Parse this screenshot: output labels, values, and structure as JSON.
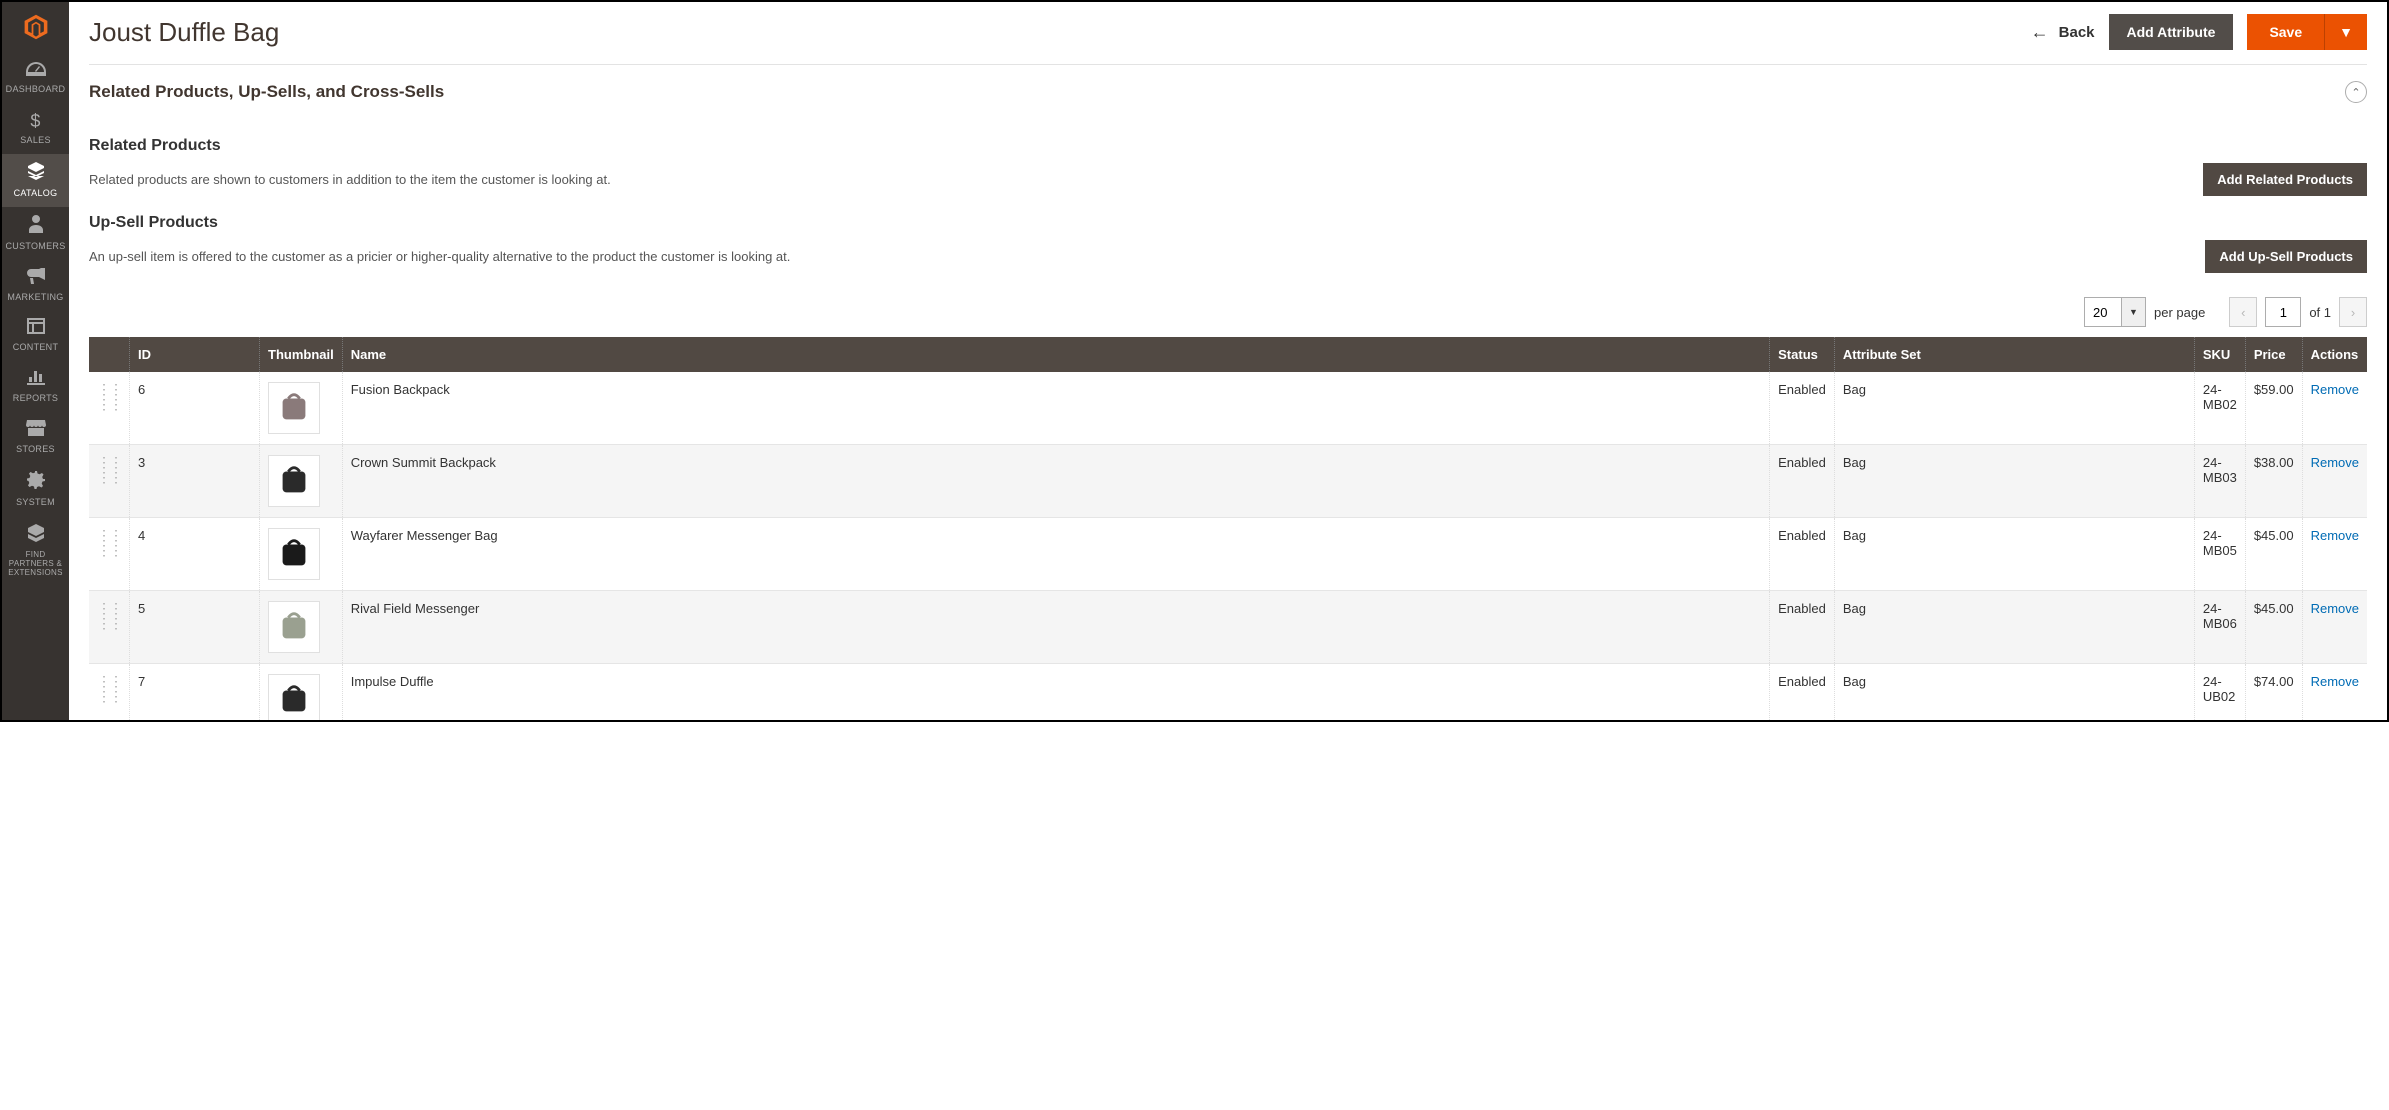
{
  "page_title": "Joust Duffle Bag",
  "header": {
    "back_label": "Back",
    "add_attribute_label": "Add Attribute",
    "save_label": "Save"
  },
  "sidebar": {
    "items": [
      {
        "label": "DASHBOARD"
      },
      {
        "label": "SALES"
      },
      {
        "label": "CATALOG"
      },
      {
        "label": "CUSTOMERS"
      },
      {
        "label": "MARKETING"
      },
      {
        "label": "CONTENT"
      },
      {
        "label": "REPORTS"
      },
      {
        "label": "STORES"
      },
      {
        "label": "SYSTEM"
      },
      {
        "label": "FIND PARTNERS & EXTENSIONS"
      }
    ]
  },
  "section": {
    "title": "Related Products, Up-Sells, and Cross-Sells"
  },
  "related": {
    "title": "Related Products",
    "desc": "Related products are shown to customers in addition to the item the customer is looking at.",
    "add_label": "Add Related Products"
  },
  "upsell": {
    "title": "Up-Sell Products",
    "desc": "An up-sell item is offered to the customer as a pricier or higher-quality alternative to the product the customer is looking at.",
    "add_label": "Add Up-Sell Products"
  },
  "pager": {
    "per_page_value": "20",
    "per_page_label": "per page",
    "page_value": "1",
    "of_label": "of 1"
  },
  "columns": {
    "id": "ID",
    "thumbnail": "Thumbnail",
    "name": "Name",
    "status": "Status",
    "attribute_set": "Attribute Set",
    "sku": "SKU",
    "price": "Price",
    "actions": "Actions"
  },
  "rows": [
    {
      "id": "6",
      "name": "Fusion Backpack",
      "status": "Enabled",
      "attribute_set": "Bag",
      "sku": "24-MB02",
      "price": "$59.00",
      "action": "Remove",
      "color": "#8a7a7a"
    },
    {
      "id": "3",
      "name": "Crown Summit Backpack",
      "status": "Enabled",
      "attribute_set": "Bag",
      "sku": "24-MB03",
      "price": "$38.00",
      "action": "Remove",
      "color": "#2a2a2a"
    },
    {
      "id": "4",
      "name": "Wayfarer Messenger Bag",
      "status": "Enabled",
      "attribute_set": "Bag",
      "sku": "24-MB05",
      "price": "$45.00",
      "action": "Remove",
      "color": "#1a1a1a"
    },
    {
      "id": "5",
      "name": "Rival Field Messenger",
      "status": "Enabled",
      "attribute_set": "Bag",
      "sku": "24-MB06",
      "price": "$45.00",
      "action": "Remove",
      "color": "#9aa090"
    },
    {
      "id": "7",
      "name": "Impulse Duffle",
      "status": "Enabled",
      "attribute_set": "Bag",
      "sku": "24-UB02",
      "price": "$74.00",
      "action": "Remove",
      "color": "#2a2a2a"
    }
  ]
}
